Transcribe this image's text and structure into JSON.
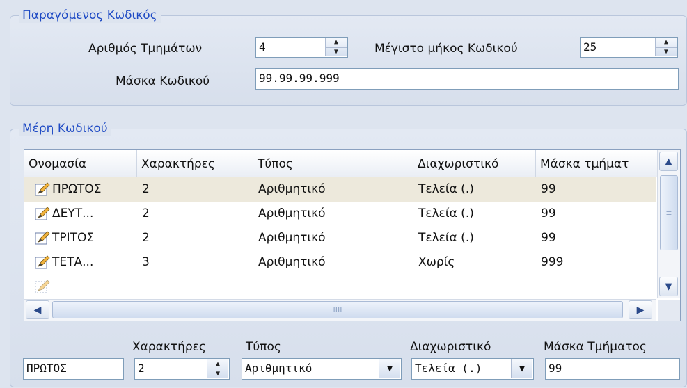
{
  "generated_code": {
    "legend": "Παραγόμενος Κωδικός",
    "segments_label": "Αριθμός Τμημάτων",
    "segments_value": "4",
    "max_length_label": "Μέγιστο μήκος Κωδικού",
    "max_length_value": "25",
    "mask_label": "Μάσκα Κωδικού",
    "mask_value": "99.99.99.999"
  },
  "code_parts": {
    "legend": "Μέρη Κωδικού",
    "columns": [
      "Ονομασία",
      "Χαρακτήρες",
      "Τύπος",
      "Διαχωριστικό",
      "Μάσκα τμήματ"
    ],
    "rows": [
      {
        "name": "ΠΡΩΤΟΣ",
        "chars": "2",
        "type": "Αριθμητικό",
        "separator": "Τελεία (.)",
        "mask": "99"
      },
      {
        "name": "ΔΕΥΤ...",
        "chars": "2",
        "type": "Αριθμητικό",
        "separator": "Τελεία (.)",
        "mask": "99"
      },
      {
        "name": "ΤΡΙΤΟΣ",
        "chars": "2",
        "type": "Αριθμητικό",
        "separator": "Τελεία (.)",
        "mask": "99"
      },
      {
        "name": "ΤΕΤΑ...",
        "chars": "3",
        "type": "Αριθμητικό",
        "separator": "Χωρίς",
        "mask": "999"
      }
    ],
    "selected_row": 0,
    "scroll_grip": "IIII"
  },
  "editor": {
    "chars_label": "Χαρακτήρες",
    "type_label": "Τύπος",
    "separator_label": "Διαχωριστικό",
    "mask_label": "Μάσκα Τμήματος",
    "name_value": "ΠΡΩΤΟΣ",
    "chars_value": "2",
    "type_value": "Αριθμητικό",
    "separator_value": "Τελεία (.)",
    "mask_value": "99"
  },
  "colors": {
    "accent": "#1d49c4",
    "background": "#dde4ef",
    "selected_row": "#ede9dc"
  },
  "icons": {
    "row_icon": "edit-pencil-icon",
    "spin": "spin-updown-icon",
    "dropdown": "chevron-down-icon"
  }
}
